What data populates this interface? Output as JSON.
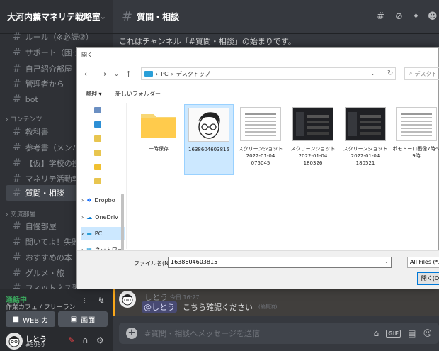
{
  "server": {
    "name": "大河内薫マネリテ戦略室"
  },
  "channels_top": [
    {
      "label": "ルール（※必読②）"
    },
    {
      "label": "サポート（困った..."
    },
    {
      "label": "自己紹介部屋"
    },
    {
      "label": "管理者から"
    },
    {
      "label": "bot"
    }
  ],
  "category_content": "コンテンツ",
  "channels_content": [
    {
      "label": "教科書"
    },
    {
      "label": "参考書（メンバー..."
    },
    {
      "label": "【仮】学校の授業..."
    },
    {
      "label": "マネリテ活動報告..."
    },
    {
      "label": "質問・相談"
    }
  ],
  "category_social": "交流部屋",
  "channels_social": [
    {
      "label": "自慢部屋"
    },
    {
      "label": "聞いてよ！失敗談..."
    },
    {
      "label": "おすすめの本"
    },
    {
      "label": "グルメ・旅"
    },
    {
      "label": "フィットネス習慣..."
    }
  ],
  "voice": {
    "status": "通話中",
    "sub": "作業カフェ / フリーラン...",
    "video_label": "WEB カ",
    "screen_label": "画面"
  },
  "user": {
    "name": "しとう",
    "discriminator": "#5959"
  },
  "channel": {
    "title": "質問・相談",
    "welcome": "これはチャンネル「#質問・相談」の始まりです。"
  },
  "message": {
    "author": "しとう",
    "time": "今日 16:27",
    "mention": "@しとう",
    "text": "こちら確認ください",
    "edited": "(編集済)"
  },
  "composer": {
    "placeholder": "#質問・相談へメッセージを送信"
  },
  "dialog": {
    "title": "開く",
    "path_pc": "PC",
    "path_folder": "デスクトップ",
    "search_placeholder": "デスクト",
    "organize": "整理 ▾",
    "new_folder": "新しいフォルダー",
    "nav": [
      {
        "label": "Dropbo"
      },
      {
        "label": "OneDriv"
      },
      {
        "label": "PC"
      },
      {
        "label": "ネットワー"
      }
    ],
    "files": [
      {
        "name": "一時保存",
        "kind": "folder"
      },
      {
        "name": "1638604603815",
        "kind": "photo"
      },
      {
        "name": "スクリーンショット 2022-01-04 075045",
        "kind": "doc"
      },
      {
        "name": "スクリーンショット 2022-01-04 180326",
        "kind": "shot"
      },
      {
        "name": "スクリーンショット 2022-01-04 180521",
        "kind": "shot"
      },
      {
        "name": "ポモドーロ画像7時～9時",
        "kind": "doc"
      }
    ],
    "filename_label": "ファイル名(N):",
    "filename_value": "1638604603815",
    "filter": "All Files (*.*)",
    "open_label": "開く(O)"
  },
  "colors": {
    "sidebar": "#2f3136",
    "chat": "#36393f",
    "voice_green": "#3ba55d",
    "selection": "#cce8ff"
  }
}
